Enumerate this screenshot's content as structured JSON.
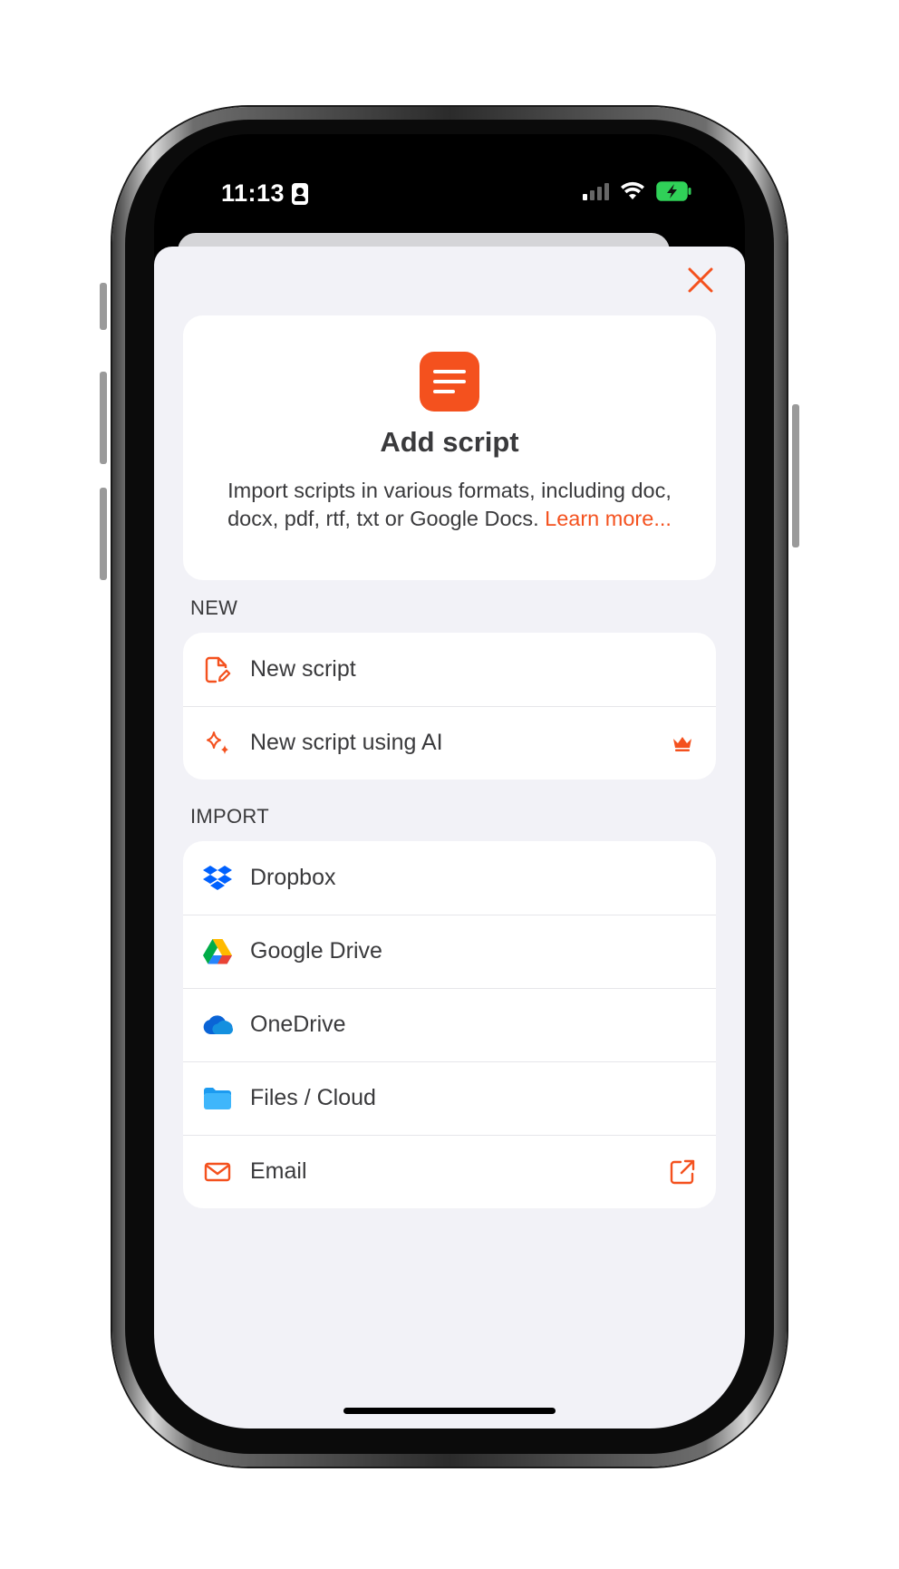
{
  "status_bar": {
    "time": "11:13"
  },
  "hero": {
    "title": "Add script",
    "description": "Import scripts in various formats, including doc, docx, pdf, rtf, txt or Google Docs.",
    "learn_more": "Learn more..."
  },
  "sections": {
    "new_label": "NEW",
    "import_label": "IMPORT"
  },
  "new_items": [
    {
      "label": "New script",
      "icon": "new-script-icon"
    },
    {
      "label": "New script using AI",
      "icon": "sparkle-icon",
      "badge": "crown-icon"
    }
  ],
  "import_items": [
    {
      "label": "Dropbox",
      "icon": "dropbox-icon"
    },
    {
      "label": "Google Drive",
      "icon": "google-drive-icon"
    },
    {
      "label": "OneDrive",
      "icon": "onedrive-icon"
    },
    {
      "label": "Files / Cloud",
      "icon": "folder-icon"
    },
    {
      "label": "Email",
      "icon": "mail-icon",
      "trail": "external-link-icon"
    }
  ],
  "colors": {
    "accent": "#f4511e",
    "sheet_background": "#f2f2f7",
    "card_background": "#ffffff",
    "text": "#3a3a3c"
  }
}
